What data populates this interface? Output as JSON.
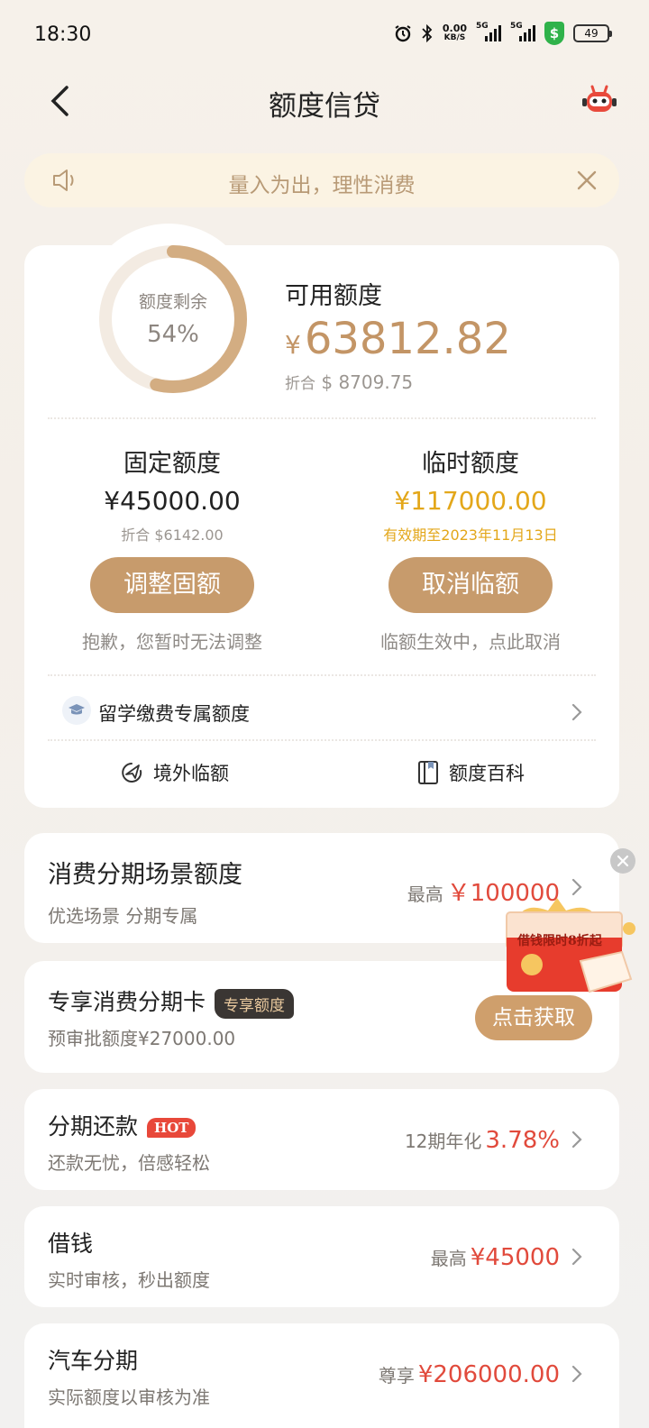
{
  "status_bar": {
    "time": "18:30",
    "net_speed": "0.00",
    "net_unit": "KB/S",
    "signal_tag": "5G",
    "battery": "49"
  },
  "nav": {
    "title": "额度信贷"
  },
  "notice": {
    "text": "量入为出，理性消费"
  },
  "quota": {
    "ring_label": "额度剩余",
    "ring_percent": "54%",
    "ring_fraction": 0.54,
    "available_title": "可用额度",
    "available_currency": "¥",
    "available_amount": "63812.82",
    "usd_prefix": "折合",
    "usd_amount": "$ 8709.75",
    "fixed": {
      "title": "固定额度",
      "amount": "¥45000.00",
      "sub": "折合 $6142.00",
      "button": "调整固额",
      "note": "抱歉，您暂时无法调整"
    },
    "temp": {
      "title": "临时额度",
      "amount": "¥117000.00",
      "sub": "有效期至2023年11月13日",
      "button": "取消临额",
      "note": "临额生效中，点此取消"
    },
    "study_label": "留学缴费专属额度",
    "tools": {
      "overseas": "境外临额",
      "wiki": "额度百科"
    }
  },
  "cards": {
    "scene": {
      "title": "消费分期场景额度",
      "sub": "优选场景 分期专属",
      "prefix": "最高",
      "value": "￥100000"
    },
    "exclusive": {
      "title": "专享消费分期卡",
      "badge": "专享额度",
      "sub": "预审批额度¥27000.00",
      "button": "点击获取"
    },
    "repay": {
      "title": "分期还款",
      "badge": "HOT",
      "sub": "还款无忧，倍感轻松",
      "prefix": "12期年化",
      "value": "3.78%"
    },
    "borrow": {
      "title": "借钱",
      "sub": "实时审核，秒出额度",
      "prefix": "最高",
      "value": "¥45000"
    },
    "car": {
      "title": "汽车分期",
      "sub": "实际额度以审核为准",
      "prefix": "尊享",
      "value": "¥206000.00"
    }
  },
  "promo": {
    "text": "借钱限时8折起"
  },
  "colors": {
    "accent": "#c79b6c",
    "gold_text": "#e3a71a",
    "red_value": "#e14a3c"
  }
}
